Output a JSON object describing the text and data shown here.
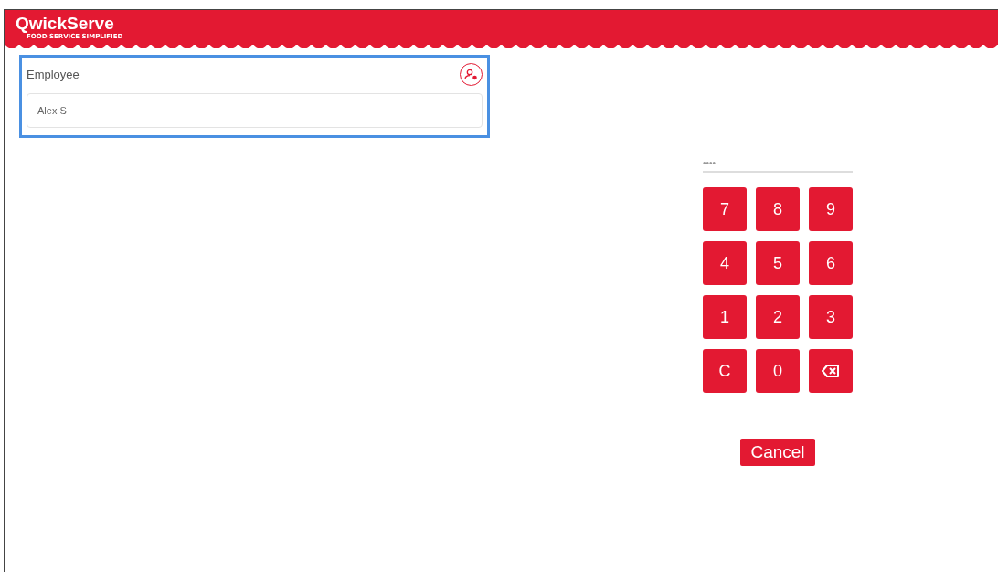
{
  "header": {
    "logo": "QwickServe",
    "tagline": "FOOD SERVICE SIMPLIFIED"
  },
  "employee_card": {
    "label": "Employee",
    "value": "Alex S"
  },
  "pin_field": {
    "placeholder": "••••"
  },
  "keypad": [
    {
      "kind": "digit",
      "label": "7"
    },
    {
      "kind": "digit",
      "label": "8"
    },
    {
      "kind": "digit",
      "label": "9"
    },
    {
      "kind": "digit",
      "label": "4"
    },
    {
      "kind": "digit",
      "label": "5"
    },
    {
      "kind": "digit",
      "label": "6"
    },
    {
      "kind": "digit",
      "label": "1"
    },
    {
      "kind": "digit",
      "label": "2"
    },
    {
      "kind": "digit",
      "label": "3"
    },
    {
      "kind": "digit",
      "label": "C"
    },
    {
      "kind": "digit",
      "label": "0"
    },
    {
      "kind": "backspace"
    }
  ],
  "cancel_button": "Cancel"
}
